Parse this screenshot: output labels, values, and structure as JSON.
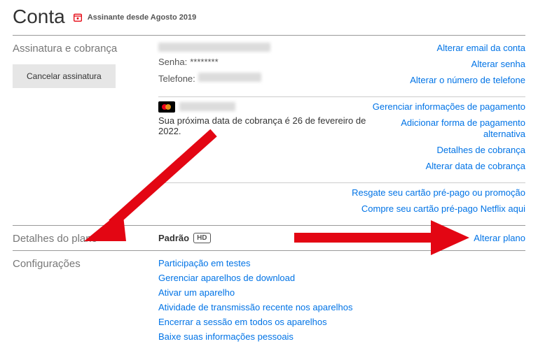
{
  "header": {
    "title": "Conta",
    "subscriber_since": "Assinante desde Agosto 2019"
  },
  "membership": {
    "section_title": "Assinatura e cobrança",
    "cancel_button": "Cancelar assinatura",
    "password_label": "Senha:",
    "password_value": "********",
    "phone_label": "Telefone:",
    "next_billing": "Sua próxima data de cobrança é 26 de fevereiro de 2022.",
    "links_top": [
      "Alterar email da conta",
      "Alterar senha",
      "Alterar o número de telefone"
    ],
    "links_mid": [
      "Gerenciar informações de pagamento",
      "Adicionar forma de pagamento alternativa",
      "Detalhes de cobrança",
      "Alterar data de cobrança"
    ],
    "links_bottom": [
      "Resgate seu cartão pré-pago ou promoção",
      "Compre seu cartão pré-pago Netflix aqui"
    ]
  },
  "plan": {
    "section_title": "Detalhes do plano",
    "plan_name": "Padrão",
    "plan_badge": "HD",
    "change_link": "Alterar plano"
  },
  "settings": {
    "section_title": "Configurações",
    "links": [
      "Participação em testes",
      "Gerenciar aparelhos de download",
      "Ativar um aparelho",
      "Atividade de transmissão recente nos aparelhos",
      "Encerrar a sessão em todos os aparelhos",
      "Baixe suas informações pessoais"
    ]
  }
}
